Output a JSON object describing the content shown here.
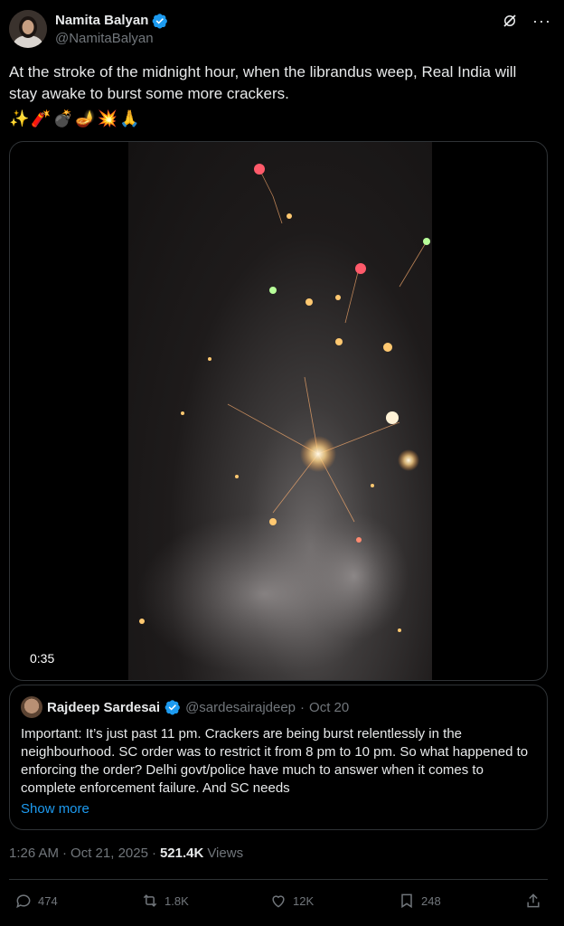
{
  "author": {
    "name": "Namita Balyan",
    "handle": "@NamitaBalyan"
  },
  "post": {
    "text": "At the stroke of the midnight hour, when the librandus weep, Real India will stay awake to burst some more crackers.",
    "emojis": [
      "✨",
      "🧨",
      "💣",
      "🪔",
      "💥",
      "🙏"
    ]
  },
  "media": {
    "duration": "0:35"
  },
  "quote": {
    "name": "Rajdeep Sardesai",
    "handle": "@sardesairajdeep",
    "separator": "·",
    "date": "Oct 20",
    "text": "Important: It’s just past 11 pm. Crackers are being burst relentlessly in the neighbourhood. SC order was to restrict it from 8 pm to 10 pm. So what happened to enforcing the order? Delhi govt/police have much to answer when it comes to complete enforcement failure. And SC needs",
    "show_more": "Show more"
  },
  "meta": {
    "time": "1:26 AM",
    "dot1": "·",
    "date": "Oct 21, 2025",
    "dot2": "·",
    "views_count": "521.4K",
    "views_label": "Views"
  },
  "actions": {
    "replies": "474",
    "reposts": "1.8K",
    "likes": "12K",
    "bookmarks": "248"
  },
  "colors": {
    "accent": "#1d9bf0",
    "muted": "#71767b",
    "border": "#2f3336"
  }
}
